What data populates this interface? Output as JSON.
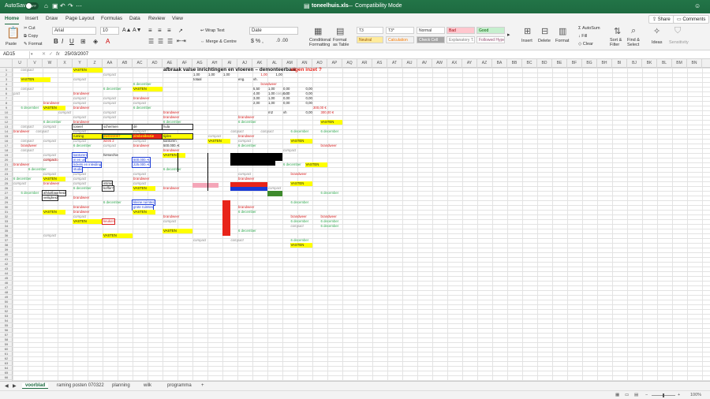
{
  "window": {
    "autosave_label": "AutoSave",
    "autosave_state": "OFF",
    "filename": "toneelhuis.xls",
    "mode": "Compatibility Mode"
  },
  "ribbon_tabs": [
    "Home",
    "Insert",
    "Draw",
    "Page Layout",
    "Formulas",
    "Data",
    "Review",
    "View"
  ],
  "ribbon_right": {
    "share": "Share",
    "comments": "Comments"
  },
  "ribbon": {
    "paste": "Paste",
    "cut": "Cut",
    "copy": "Copy",
    "format": "Format",
    "font": "Arial",
    "size": "10",
    "wrap": "Wrap Text",
    "merge": "Merge & Centre",
    "number_format": "Date",
    "cond_format": "Conditional Formatting",
    "format_table": "Format as Table",
    "styles": [
      {
        "label": "T3",
        "bg": "#ffffff",
        "color": "#333"
      },
      {
        "label": "T3*",
        "bg": "#ffffff",
        "color": "#333"
      },
      {
        "label": "Normal",
        "bg": "#ffffff",
        "color": "#333"
      },
      {
        "label": "Bad",
        "bg": "#ffc7ce",
        "color": "#9c0006"
      },
      {
        "label": "Good",
        "bg": "#c6efce",
        "color": "#006100"
      },
      {
        "label": "Neutral",
        "bg": "#ffeb9c",
        "color": "#9c5700"
      },
      {
        "label": "Calculation",
        "bg": "#f2f2f2",
        "color": "#fa7d00"
      },
      {
        "label": "Check Cell",
        "bg": "#a5a5a5",
        "color": "#ffffff"
      },
      {
        "label": "Explanatory T...",
        "bg": "#ffffff",
        "color": "#7f7f7f"
      },
      {
        "label": "Followed Hyperlink",
        "bg": "#ffffff",
        "color": "#954f72"
      }
    ],
    "insert": "Insert",
    "delete": "Delete",
    "format_cells": "Format",
    "autosum": "AutoSum",
    "fill": "Fill",
    "clear": "Clear",
    "sort": "Sort & Filter",
    "find": "Find & Select",
    "ideas": "Ideas",
    "sensitivity": "Sensitivity"
  },
  "formula_bar": {
    "cell": "AD15",
    "fx": "fx",
    "value": "25/03/2007"
  },
  "columns": [
    "U",
    "V",
    "W",
    "X",
    "Y",
    "Z",
    "AA",
    "AB",
    "AC",
    "AD",
    "AE",
    "AF",
    "AG",
    "AH",
    "AI",
    "AJ",
    "AK",
    "AL",
    "AM",
    "AN",
    "AO",
    "AP",
    "AQ",
    "AR",
    "AS",
    "AT",
    "AU",
    "AV",
    "AW",
    "AX",
    "AY",
    "AZ",
    "BA",
    "BB",
    "BC",
    "BD",
    "BE",
    "BF",
    "BG",
    "BH",
    "BI",
    "BJ",
    "BK",
    "BL",
    "BM",
    "BN"
  ],
  "rows": [
    "1",
    "2",
    "3",
    "4",
    "5",
    "6",
    "7",
    "8",
    "9",
    "10",
    "11",
    "12",
    "13",
    "14",
    "15",
    "16",
    "17",
    "18",
    "19",
    "20",
    "21",
    "22",
    "23",
    "24",
    "25",
    "26",
    "27",
    "28",
    "29",
    "30",
    "31",
    "32",
    "33",
    "34",
    "35",
    "36",
    "37",
    "38",
    "39",
    "40",
    "41",
    "42",
    "43",
    "44",
    "45",
    "46",
    "47",
    "48",
    "49",
    "50",
    "51",
    "52",
    "53",
    "54",
    "55",
    "56",
    "57",
    "58",
    "59",
    "60",
    "61",
    "62",
    "63",
    "64",
    "65",
    "66"
  ],
  "cells": [
    {
      "r": 1,
      "c": 1,
      "t": "compact",
      "k": "g"
    },
    {
      "r": 1,
      "c": 8,
      "t": "VASTEN",
      "k": "y",
      "w": 4
    },
    {
      "r": 1,
      "c": 20,
      "t": "afbraak valse inrichtingen en vloeren – demonteerbaar - ",
      "k": "title"
    },
    {
      "r": 1,
      "c": 37,
      "t": "eigen inzet ?",
      "k": "titlered"
    },
    {
      "r": 2,
      "c": 12,
      "t": "compact",
      "k": "g"
    },
    {
      "r": 2,
      "c": 24,
      "t": "1,00",
      "k": "n"
    },
    {
      "r": 2,
      "c": 26,
      "t": "1,00",
      "k": "n"
    },
    {
      "r": 2,
      "c": 28,
      "t": "1,00",
      "k": "n"
    },
    {
      "r": 2,
      "c": 33,
      "t": "1,00",
      "k": "r"
    },
    {
      "r": 2,
      "c": 35,
      "t": "1,00",
      "k": "n"
    },
    {
      "r": 3,
      "c": 1,
      "t": "VASTEN",
      "k": "y",
      "w": 4
    },
    {
      "r": 3,
      "c": 8,
      "t": "compact",
      "k": "g"
    },
    {
      "r": 3,
      "c": 24,
      "t": "totaal",
      "k": "n"
    },
    {
      "r": 3,
      "c": 30,
      "t": "eng.",
      "k": "n"
    },
    {
      "r": 3,
      "c": 32,
      "t": "vh.",
      "k": "n"
    },
    {
      "r": 4,
      "c": 16,
      "t": "6 december",
      "k": "gr"
    },
    {
      "r": 4,
      "c": 33,
      "t": "brandweer",
      "k": "rd"
    },
    {
      "r": 5,
      "c": 1,
      "t": "compact",
      "k": "g"
    },
    {
      "r": 5,
      "c": 12,
      "t": "6 december",
      "k": "gr"
    },
    {
      "r": 5,
      "c": 16,
      "t": "VASTEN",
      "k": "y",
      "w": 4
    },
    {
      "r": 5,
      "c": 32,
      "t": "5,50",
      "k": "n"
    },
    {
      "r": 5,
      "c": 34,
      "t": "1,00",
      "k": "n"
    },
    {
      "r": 5,
      "c": 36,
      "t": "0,00",
      "k": "n"
    },
    {
      "r": 5,
      "c": 39,
      "t": "0,00",
      "k": "n"
    },
    {
      "r": 6,
      "c": 0,
      "t": "pact",
      "k": "g"
    },
    {
      "r": 6,
      "c": 8,
      "t": "brandweer",
      "k": "rd"
    },
    {
      "r": 6,
      "c": 32,
      "t": "4,00",
      "k": "n"
    },
    {
      "r": 6,
      "c": 34,
      "t": "1,00",
      "k": "n"
    },
    {
      "r": 6,
      "c": 36,
      "t": "0,00",
      "k": "n"
    },
    {
      "r": 6,
      "c": 39,
      "t": "0,00",
      "k": "n"
    },
    {
      "r": 6,
      "c": 35,
      "t": "compact",
      "k": "g"
    },
    {
      "r": 7,
      "c": 8,
      "t": "compact",
      "k": "g"
    },
    {
      "r": 7,
      "c": 12,
      "t": "compact",
      "k": "g"
    },
    {
      "r": 7,
      "c": 16,
      "t": "brandweer",
      "k": "rd"
    },
    {
      "r": 7,
      "c": 32,
      "t": "3,00",
      "k": "n"
    },
    {
      "r": 7,
      "c": 34,
      "t": "1,00",
      "k": "n"
    },
    {
      "r": 7,
      "c": 36,
      "t": "0,00",
      "k": "n"
    },
    {
      "r": 7,
      "c": 39,
      "t": "0,00",
      "k": "n"
    },
    {
      "r": 8,
      "c": 4,
      "t": "brandweer",
      "k": "rd"
    },
    {
      "r": 8,
      "c": 8,
      "t": "compact",
      "k": "g"
    },
    {
      "r": 8,
      "c": 12,
      "t": "compact",
      "k": "g"
    },
    {
      "r": 8,
      "c": 16,
      "t": "compact",
      "k": "g"
    },
    {
      "r": 8,
      "c": 32,
      "t": "2,00",
      "k": "n"
    },
    {
      "r": 8,
      "c": 34,
      "t": "1,00",
      "k": "n"
    },
    {
      "r": 8,
      "c": 36,
      "t": "0,00",
      "k": "n"
    },
    {
      "r": 8,
      "c": 39,
      "t": "0,00",
      "k": "n"
    },
    {
      "r": 9,
      "c": 1,
      "t": "6 december",
      "k": "gr"
    },
    {
      "r": 9,
      "c": 4,
      "t": "VASTEN",
      "k": "y",
      "w": 3
    },
    {
      "r": 9,
      "c": 8,
      "t": "brandweer",
      "k": "rd"
    },
    {
      "r": 9,
      "c": 16,
      "t": "6 december",
      "k": "gr"
    },
    {
      "r": 9,
      "c": 40,
      "t": "300,00 €",
      "k": "r"
    },
    {
      "r": 10,
      "c": 6,
      "t": "compact",
      "k": "g"
    },
    {
      "r": 10,
      "c": 12,
      "t": "compact",
      "k": "g"
    },
    {
      "r": 10,
      "c": 20,
      "t": "brandweer",
      "k": "rd"
    },
    {
      "r": 10,
      "c": 34,
      "t": "m2",
      "k": "n"
    },
    {
      "r": 10,
      "c": 36,
      "t": "vh",
      "k": "n"
    },
    {
      "r": 10,
      "c": 39,
      "t": "0,00",
      "k": "n"
    },
    {
      "r": 10,
      "c": 41,
      "t": "300,00 €",
      "k": "r"
    },
    {
      "r": 11,
      "c": 8,
      "t": "compact",
      "k": "g"
    },
    {
      "r": 11,
      "c": 12,
      "t": "compact",
      "k": "g"
    },
    {
      "r": 11,
      "c": 20,
      "t": "brandweer",
      "k": "rd"
    },
    {
      "r": 11,
      "c": 30,
      "t": "brandweer",
      "k": "rd"
    },
    {
      "r": 12,
      "c": 4,
      "t": "6 december",
      "k": "gr"
    },
    {
      "r": 12,
      "c": 8,
      "t": "brandweer",
      "k": "rd"
    },
    {
      "r": 12,
      "c": 20,
      "t": "6 december",
      "k": "gr"
    },
    {
      "r": 12,
      "c": 30,
      "t": "6 december",
      "k": "gr"
    },
    {
      "r": 12,
      "c": 41,
      "t": "VASTEN",
      "k": "y",
      "w": 3
    },
    {
      "r": 13,
      "c": 1,
      "t": "compact",
      "k": "g"
    },
    {
      "r": 13,
      "c": 4,
      "t": "compact",
      "k": "g"
    },
    {
      "r": 13,
      "c": 8,
      "t": "toneel",
      "k": "bx",
      "w": 4
    },
    {
      "r": 13,
      "c": 12,
      "t": "schermen",
      "k": "bx",
      "w": 4
    },
    {
      "r": 13,
      "c": 16,
      "t": "dé",
      "k": "bx",
      "w": 4
    },
    {
      "r": 13,
      "c": 20,
      "t": "hula",
      "k": "bx",
      "w": 4
    },
    {
      "r": 14,
      "c": 0,
      "t": "brandweer",
      "k": "rd"
    },
    {
      "r": 14,
      "c": 3,
      "t": "compact",
      "k": "g"
    },
    {
      "r": 14,
      "c": 8,
      "t": "compact",
      "k": "g"
    },
    {
      "r": 14,
      "c": 16,
      "t": "compact",
      "k": "g"
    },
    {
      "r": 14,
      "c": 29,
      "t": "compact",
      "k": "g"
    },
    {
      "r": 14,
      "c": 33,
      "t": "compact",
      "k": "g"
    },
    {
      "r": 14,
      "c": 37,
      "t": "6 december",
      "k": "gr"
    },
    {
      "r": 14,
      "c": 41,
      "t": "6 december",
      "k": "gr"
    },
    {
      "r": 15,
      "c": 8,
      "t": "ruming",
      "k": "yb",
      "w": 4
    },
    {
      "r": 15,
      "c": 12,
      "t": "25/03/2007",
      "k": "ybr",
      "w": 4
    },
    {
      "r": 15,
      "c": 16,
      "t": "zitsbreilectie",
      "k": "rb",
      "w": 4
    },
    {
      "r": 15,
      "c": 20,
      "t": "tijdes",
      "k": "yb",
      "w": 4
    },
    {
      "r": 15,
      "c": 26,
      "t": "compact",
      "k": "g"
    },
    {
      "r": 15,
      "c": 30,
      "t": "brandweer",
      "k": "rd"
    },
    {
      "r": 16,
      "c": 1,
      "t": "compact",
      "k": "g"
    },
    {
      "r": 16,
      "c": 4,
      "t": "compact",
      "k": "g"
    },
    {
      "r": 16,
      "c": 8,
      "t": "compact",
      "k": "g"
    },
    {
      "r": 16,
      "c": 12,
      "t": "week 2",
      "k": "rd"
    },
    {
      "r": 16,
      "c": 16,
      "t": "compact",
      "k": "g"
    },
    {
      "r": 16,
      "c": 20,
      "t": "kantoren",
      "k": "n"
    },
    {
      "r": 16,
      "c": 26,
      "t": "VASTEN",
      "k": "y",
      "w": 3
    },
    {
      "r": 16,
      "c": 30,
      "t": "compact",
      "k": "g"
    },
    {
      "r": 16,
      "c": 37,
      "t": "VASTEN",
      "k": "y",
      "w": 3
    },
    {
      "r": 17,
      "c": 1,
      "t": "brandweer",
      "k": "rd"
    },
    {
      "r": 17,
      "c": 8,
      "t": "6 december",
      "k": "gr"
    },
    {
      "r": 17,
      "c": 12,
      "t": "compact",
      "k": "g"
    },
    {
      "r": 17,
      "c": 16,
      "t": "brandweer",
      "k": "rd"
    },
    {
      "r": 17,
      "c": 20,
      "t": "500.000,-€",
      "k": "n"
    },
    {
      "r": 17,
      "c": 30,
      "t": "6 december",
      "k": "gr"
    },
    {
      "r": 17,
      "c": 41,
      "t": "brandweer",
      "k": "rd"
    },
    {
      "r": 18,
      "c": 1,
      "t": "compact",
      "k": "g"
    },
    {
      "r": 18,
      "c": 20,
      "t": "brandweer",
      "k": "rd"
    },
    {
      "r": 18,
      "c": 36,
      "t": "compact",
      "k": "g"
    },
    {
      "r": 19,
      "c": 4,
      "t": "compact",
      "k": "g"
    },
    {
      "r": 19,
      "c": 8,
      "t": "kantoren",
      "k": "bb"
    },
    {
      "r": 19,
      "c": 12,
      "t": "hiërarchie",
      "k": "n"
    },
    {
      "r": 19,
      "c": 20,
      "t": "VASTEN",
      "k": "y",
      "w": 3
    },
    {
      "r": 20,
      "c": 4,
      "t": "compact",
      "k": "g"
    },
    {
      "r": 20,
      "c": 4,
      "t": "compacto",
      "k": "rd"
    },
    {
      "r": 20,
      "c": 8,
      "t": "in en uit",
      "k": "bb"
    },
    {
      "r": 20,
      "c": 16,
      "t": "500.000,-€",
      "k": "bbl"
    },
    {
      "r": 20,
      "c": 30,
      "t": "compact",
      "k": "g"
    },
    {
      "r": 21,
      "c": 0,
      "t": "brandweer",
      "k": "rd"
    },
    {
      "r": 21,
      "c": 8,
      "t": "tickets en inleiding",
      "k": "bb"
    },
    {
      "r": 21,
      "c": 16,
      "t": "225.000,-€",
      "k": "bbl"
    },
    {
      "r": 21,
      "c": 36,
      "t": "6 december",
      "k": "gr"
    },
    {
      "r": 21,
      "c": 39,
      "t": "VASTEN",
      "k": "y",
      "w": 3
    },
    {
      "r": 22,
      "c": 2,
      "t": "6 december",
      "k": "gr"
    },
    {
      "r": 22,
      "c": 8,
      "t": "studio",
      "k": "bb"
    },
    {
      "r": 22,
      "c": 20,
      "t": "6 december",
      "k": "gr"
    },
    {
      "r": 23,
      "c": 4,
      "t": "compact",
      "k": "g"
    },
    {
      "r": 23,
      "c": 8,
      "t": "compact",
      "k": "g"
    },
    {
      "r": 23,
      "c": 16,
      "t": "compact",
      "k": "g"
    },
    {
      "r": 23,
      "c": 30,
      "t": "compact",
      "k": "g"
    },
    {
      "r": 23,
      "c": 37,
      "t": "brandweer",
      "k": "rd"
    },
    {
      "r": 24,
      "c": 0,
      "t": "6 december",
      "k": "gr"
    },
    {
      "r": 24,
      "c": 4,
      "t": "VASTEN",
      "k": "y",
      "w": 3
    },
    {
      "r": 24,
      "c": 8,
      "t": "compact",
      "k": "g"
    },
    {
      "r": 24,
      "c": 16,
      "t": "brandweer",
      "k": "rd"
    },
    {
      "r": 24,
      "c": 30,
      "t": "brandweer",
      "k": "rd"
    },
    {
      "r": 25,
      "c": 0,
      "t": "compact",
      "k": "g"
    },
    {
      "r": 25,
      "c": 4,
      "t": "brandweer",
      "k": "rd"
    },
    {
      "r": 25,
      "c": 8,
      "t": "compact",
      "k": "g"
    },
    {
      "r": 25,
      "c": 12,
      "t": "intime",
      "k": "bx"
    },
    {
      "r": 25,
      "c": 16,
      "t": "compact",
      "k": "g"
    },
    {
      "r": 25,
      "c": 30,
      "t": "compact",
      "k": "g"
    },
    {
      "r": 25,
      "c": 37,
      "t": "VASTEN",
      "k": "y",
      "w": 3
    },
    {
      "r": 26,
      "c": 8,
      "t": "6 december",
      "k": "gr"
    },
    {
      "r": 26,
      "c": 12,
      "t": "koffie?",
      "k": "bx"
    },
    {
      "r": 26,
      "c": 16,
      "t": "VASTEN",
      "k": "y",
      "w": 3
    },
    {
      "r": 26,
      "c": 20,
      "t": "brandweer",
      "k": "rd"
    },
    {
      "r": 26,
      "c": 34,
      "t": "compact",
      "k": "g"
    },
    {
      "r": 27,
      "c": 1,
      "t": "6 december",
      "k": "gr"
    },
    {
      "r": 27,
      "c": 4,
      "t": "afsluitbaarheid",
      "k": "bx"
    },
    {
      "r": 27,
      "c": 41,
      "t": "6 december",
      "k": "gr"
    },
    {
      "r": 28,
      "c": 4,
      "t": "veiligheid",
      "k": "bx"
    },
    {
      "r": 28,
      "c": 8,
      "t": "brandweer",
      "k": "rd"
    },
    {
      "r": 29,
      "c": 12,
      "t": "6 december",
      "k": "gr"
    },
    {
      "r": 29,
      "c": 16,
      "t": "kleine ruimtes",
      "k": "bb"
    },
    {
      "r": 29,
      "c": 37,
      "t": "6 december",
      "k": "gr"
    },
    {
      "r": 30,
      "c": 8,
      "t": "brandweer",
      "k": "rd"
    },
    {
      "r": 30,
      "c": 16,
      "t": "grote ruimtes",
      "k": "bb"
    },
    {
      "r": 30,
      "c": 30,
      "t": "brandweer",
      "k": "rd"
    },
    {
      "r": 31,
      "c": 4,
      "t": "VASTEN",
      "k": "y",
      "w": 3
    },
    {
      "r": 31,
      "c": 8,
      "t": "brandweer",
      "k": "rd"
    },
    {
      "r": 31,
      "c": 16,
      "t": "VASTEN",
      "k": "y",
      "w": 3
    },
    {
      "r": 31,
      "c": 30,
      "t": "6 december",
      "k": "gr"
    },
    {
      "r": 32,
      "c": 8,
      "t": "compact",
      "k": "g"
    },
    {
      "r": 32,
      "c": 20,
      "t": "brandweer",
      "k": "rd"
    },
    {
      "r": 32,
      "c": 37,
      "t": "brandweer",
      "k": "rd"
    },
    {
      "r": 32,
      "c": 41,
      "t": "brandweer",
      "k": "rd"
    },
    {
      "r": 33,
      "c": 8,
      "t": "VASTEN",
      "k": "y",
      "w": 4
    },
    {
      "r": 33,
      "c": 12,
      "t": "keuken",
      "k": "rx"
    },
    {
      "r": 33,
      "c": 20,
      "t": "compact",
      "k": "g"
    },
    {
      "r": 33,
      "c": 37,
      "t": "6 december",
      "k": "gr"
    },
    {
      "r": 33,
      "c": 41,
      "t": "6 december",
      "k": "gr"
    },
    {
      "r": 34,
      "c": 37,
      "t": "compact",
      "k": "g"
    },
    {
      "r": 34,
      "c": 41,
      "t": "6 december",
      "k": "gr"
    },
    {
      "r": 35,
      "c": 20,
      "t": "VASTEN",
      "k": "y",
      "w": 4
    },
    {
      "r": 35,
      "c": 30,
      "t": "6 december",
      "k": "gr"
    },
    {
      "r": 36,
      "c": 4,
      "t": "compact",
      "k": "g"
    },
    {
      "r": 36,
      "c": 12,
      "t": "VASTEN",
      "k": "y",
      "w": 4
    },
    {
      "r": 37,
      "c": 24,
      "t": "compact",
      "k": "g"
    },
    {
      "r": 37,
      "c": 29,
      "t": "compact",
      "k": "g"
    },
    {
      "r": 37,
      "c": 37,
      "t": "6 december",
      "k": "gr"
    },
    {
      "r": 38,
      "c": 37,
      "t": "VASTEN",
      "k": "y",
      "w": 3
    }
  ],
  "blocks": [
    {
      "name": "black-bar-1",
      "r": 19,
      "c": 29,
      "w": 7,
      "h": 1.6,
      "color": "#000000"
    },
    {
      "name": "black-bar-2",
      "r": 20.5,
      "c": 29,
      "w": 6,
      "h": 1.2,
      "color": "#000000"
    },
    {
      "name": "pink-bar",
      "r": 25.4,
      "c": 24,
      "w": 3.5,
      "h": 0.9,
      "color": "#f4a6b8"
    },
    {
      "name": "red-bar",
      "r": 25.2,
      "c": 29,
      "w": 5,
      "h": 0.9,
      "color": "#e8241a"
    },
    {
      "name": "blue-bar",
      "r": 26.2,
      "c": 29,
      "w": 5,
      "h": 0.8,
      "color": "#1b3bd6"
    },
    {
      "name": "green-box",
      "r": 27,
      "c": 34,
      "w": 2,
      "h": 1.1,
      "color": "#3e8a2c"
    },
    {
      "name": "red-vertical",
      "r": 29,
      "c": 28,
      "w": 1.1,
      "h": 7.5,
      "color": "#e8241a"
    }
  ],
  "sheet_tabs": [
    "voorblad",
    "raming posten 070322",
    "planning",
    "wilk",
    "programma"
  ],
  "status": {
    "zoom": "100%"
  }
}
